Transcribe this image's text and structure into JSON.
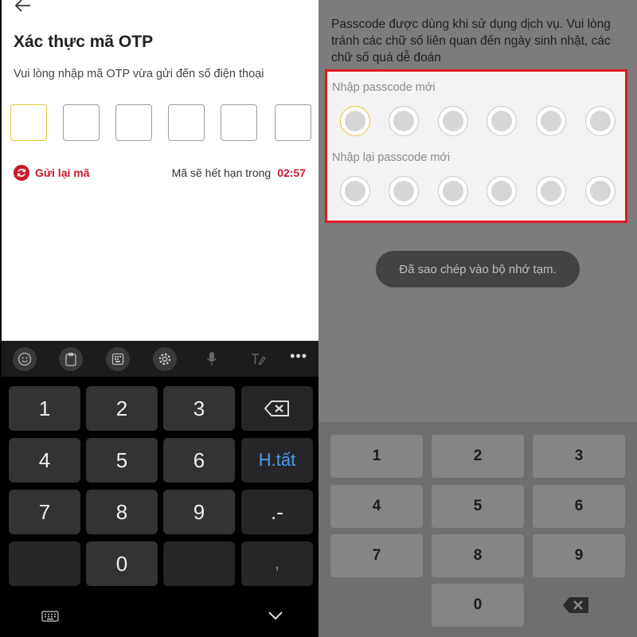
{
  "otp": {
    "title": "Xác thực mã OTP",
    "description": "Vui lòng nhập mã OTP vừa gửi đến số điện thoại",
    "resend_label": "Gửi lại mã",
    "expire_label": "Mã sẽ hết hạn trong",
    "expire_time": "02:57"
  },
  "keyboard": {
    "toolbar_icons": [
      "emoji-icon",
      "clipboard-icon",
      "keyboard-mode-icon",
      "settings-icon",
      "microphone-icon",
      "handwriting-icon",
      "more-icon"
    ],
    "more_label": "•••",
    "keys": {
      "k1": "1",
      "k2": "2",
      "k3": "3",
      "k4": "4",
      "k5": "5",
      "k6": "6",
      "k7": "7",
      "k8": "8",
      "k9": "9",
      "k0": "0",
      "done": "H.tất",
      "dot_minus": ".-",
      "comma": ","
    }
  },
  "passcode": {
    "info": "Passcode được dùng khi sử dụng dịch vụ. Vui lòng tránh các chữ số liên quan đến ngày sinh nhật, các chữ số quá dễ đoán",
    "new_label": "Nhập passcode mới",
    "confirm_label": "Nhập lại passcode mới",
    "toast": "Đã sao chép vào bộ nhớ tạm.",
    "numpad": {
      "n1": "1",
      "n2": "2",
      "n3": "3",
      "n4": "4",
      "n5": "5",
      "n6": "6",
      "n7": "7",
      "n8": "8",
      "n9": "9",
      "n0": "0"
    }
  },
  "colors": {
    "brand_red": "#c8192c",
    "active_yellow": "#e5c63a",
    "highlight_red": "#e01b22",
    "done_blue": "#4b9bf0"
  }
}
